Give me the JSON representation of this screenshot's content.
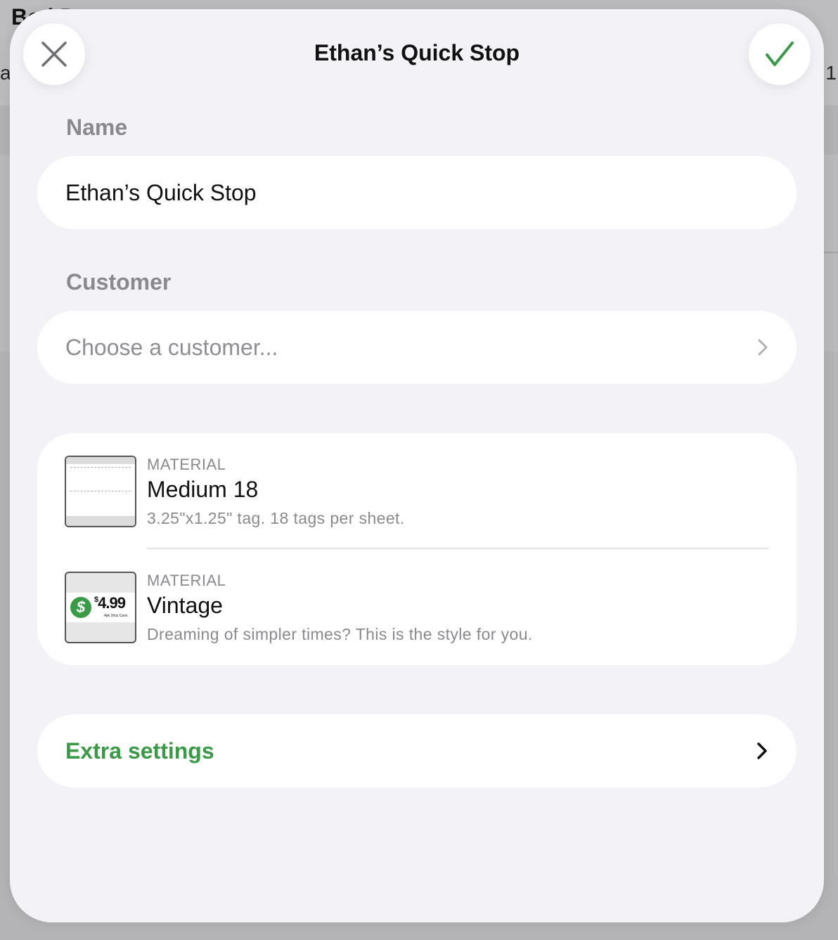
{
  "background": {
    "title_fragment": "Bo  l D",
    "left_fragment": "a",
    "right_fragment": "1"
  },
  "sheet": {
    "title": "Ethan’s Quick Stop",
    "close_icon": "close-icon",
    "confirm_icon": "checkmark-icon",
    "accent_color": "#3a9b46"
  },
  "name": {
    "label": "Name",
    "value": "Ethan’s Quick Stop"
  },
  "customer": {
    "label": "Customer",
    "placeholder": "Choose a customer..."
  },
  "materials": [
    {
      "kicker": "MATERIAL",
      "title": "Medium 18",
      "description": "3.25\"x1.25\" tag. 18 tags per sheet."
    },
    {
      "kicker": "MATERIAL",
      "title": "Vintage",
      "description": "Dreaming of simpler times? This is the style for you.",
      "thumb_price": "4.99",
      "thumb_currency": "$",
      "thumb_small": "4pk 16oz Cans"
    }
  ],
  "extra_settings": {
    "label": "Extra settings"
  }
}
